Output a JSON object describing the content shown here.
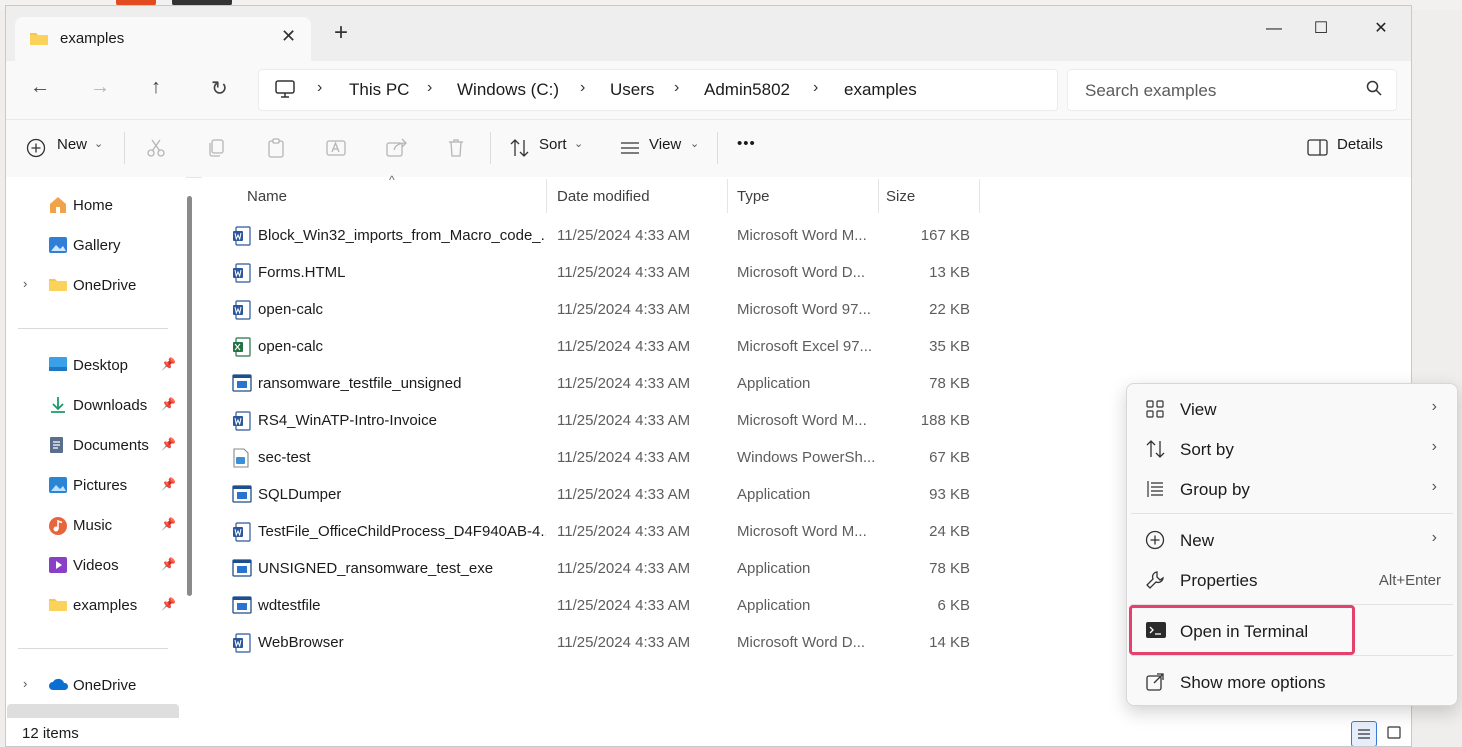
{
  "tab": {
    "title": "examples",
    "close": "✕",
    "new": "+"
  },
  "window_controls": {
    "minimize": "—",
    "maximize": "☐",
    "close": "✕"
  },
  "nav": {
    "back": "←",
    "forward": "→",
    "up": "↑",
    "refresh": "↻"
  },
  "breadcrumb": [
    "This PC",
    "Windows (C:)",
    "Users",
    "Admin5802",
    "examples"
  ],
  "search": {
    "placeholder": "Search examples"
  },
  "toolbar": {
    "new_label": "New",
    "sort_label": "Sort",
    "view_label": "View",
    "more_label": "•••",
    "details_label": "Details"
  },
  "sidebar": {
    "items": [
      {
        "label": "Home",
        "icon": "home-icon"
      },
      {
        "label": "Gallery",
        "icon": "gallery-icon"
      },
      {
        "label": "OneDrive",
        "icon": "folder-icon"
      },
      {
        "label": "Desktop",
        "icon": "desktop-icon"
      },
      {
        "label": "Downloads",
        "icon": "download-icon"
      },
      {
        "label": "Documents",
        "icon": "document-icon"
      },
      {
        "label": "Pictures",
        "icon": "pictures-icon"
      },
      {
        "label": "Music",
        "icon": "music-icon"
      },
      {
        "label": "Videos",
        "icon": "video-icon"
      },
      {
        "label": "examples",
        "icon": "folder-icon"
      },
      {
        "label": "OneDrive",
        "icon": "cloud-icon"
      }
    ]
  },
  "columns": {
    "name": "Name",
    "date": "Date modified",
    "type": "Type",
    "size": "Size"
  },
  "files": [
    {
      "name": "Block_Win32_imports_from_Macro_code_...",
      "date": "11/25/2024 4:33 AM",
      "type": "Microsoft Word M...",
      "size": "167 KB",
      "icon": "word"
    },
    {
      "name": "Forms.HTML",
      "date": "11/25/2024 4:33 AM",
      "type": "Microsoft Word D...",
      "size": "13 KB",
      "icon": "word"
    },
    {
      "name": "open-calc",
      "date": "11/25/2024 4:33 AM",
      "type": "Microsoft Word 97...",
      "size": "22 KB",
      "icon": "word"
    },
    {
      "name": "open-calc",
      "date": "11/25/2024 4:33 AM",
      "type": "Microsoft Excel 97...",
      "size": "35 KB",
      "icon": "excel"
    },
    {
      "name": "ransomware_testfile_unsigned",
      "date": "11/25/2024 4:33 AM",
      "type": "Application",
      "size": "78 KB",
      "icon": "app"
    },
    {
      "name": "RS4_WinATP-Intro-Invoice",
      "date": "11/25/2024 4:33 AM",
      "type": "Microsoft Word M...",
      "size": "188 KB",
      "icon": "word"
    },
    {
      "name": "sec-test",
      "date": "11/25/2024 4:33 AM",
      "type": "Windows PowerSh...",
      "size": "67 KB",
      "icon": "ps"
    },
    {
      "name": "SQLDumper",
      "date": "11/25/2024 4:33 AM",
      "type": "Application",
      "size": "93 KB",
      "icon": "app"
    },
    {
      "name": "TestFile_OfficeChildProcess_D4F940AB-4...",
      "date": "11/25/2024 4:33 AM",
      "type": "Microsoft Word M...",
      "size": "24 KB",
      "icon": "word"
    },
    {
      "name": "UNSIGNED_ransomware_test_exe",
      "date": "11/25/2024 4:33 AM",
      "type": "Application",
      "size": "78 KB",
      "icon": "app"
    },
    {
      "name": "wdtestfile",
      "date": "11/25/2024 4:33 AM",
      "type": "Application",
      "size": "6 KB",
      "icon": "app"
    },
    {
      "name": "WebBrowser",
      "date": "11/25/2024 4:33 AM",
      "type": "Microsoft Word D...",
      "size": "14 KB",
      "icon": "word"
    }
  ],
  "status": {
    "item_count": "12 items"
  },
  "context_menu": {
    "view": "View",
    "sort_by": "Sort by",
    "group_by": "Group by",
    "new": "New",
    "properties": "Properties",
    "properties_shortcut": "Alt+Enter",
    "open_terminal": "Open in Terminal",
    "show_more": "Show more options"
  },
  "colors": {
    "highlight": "#e5416d",
    "accent": "#0067c0",
    "folder": "#f8c647"
  }
}
